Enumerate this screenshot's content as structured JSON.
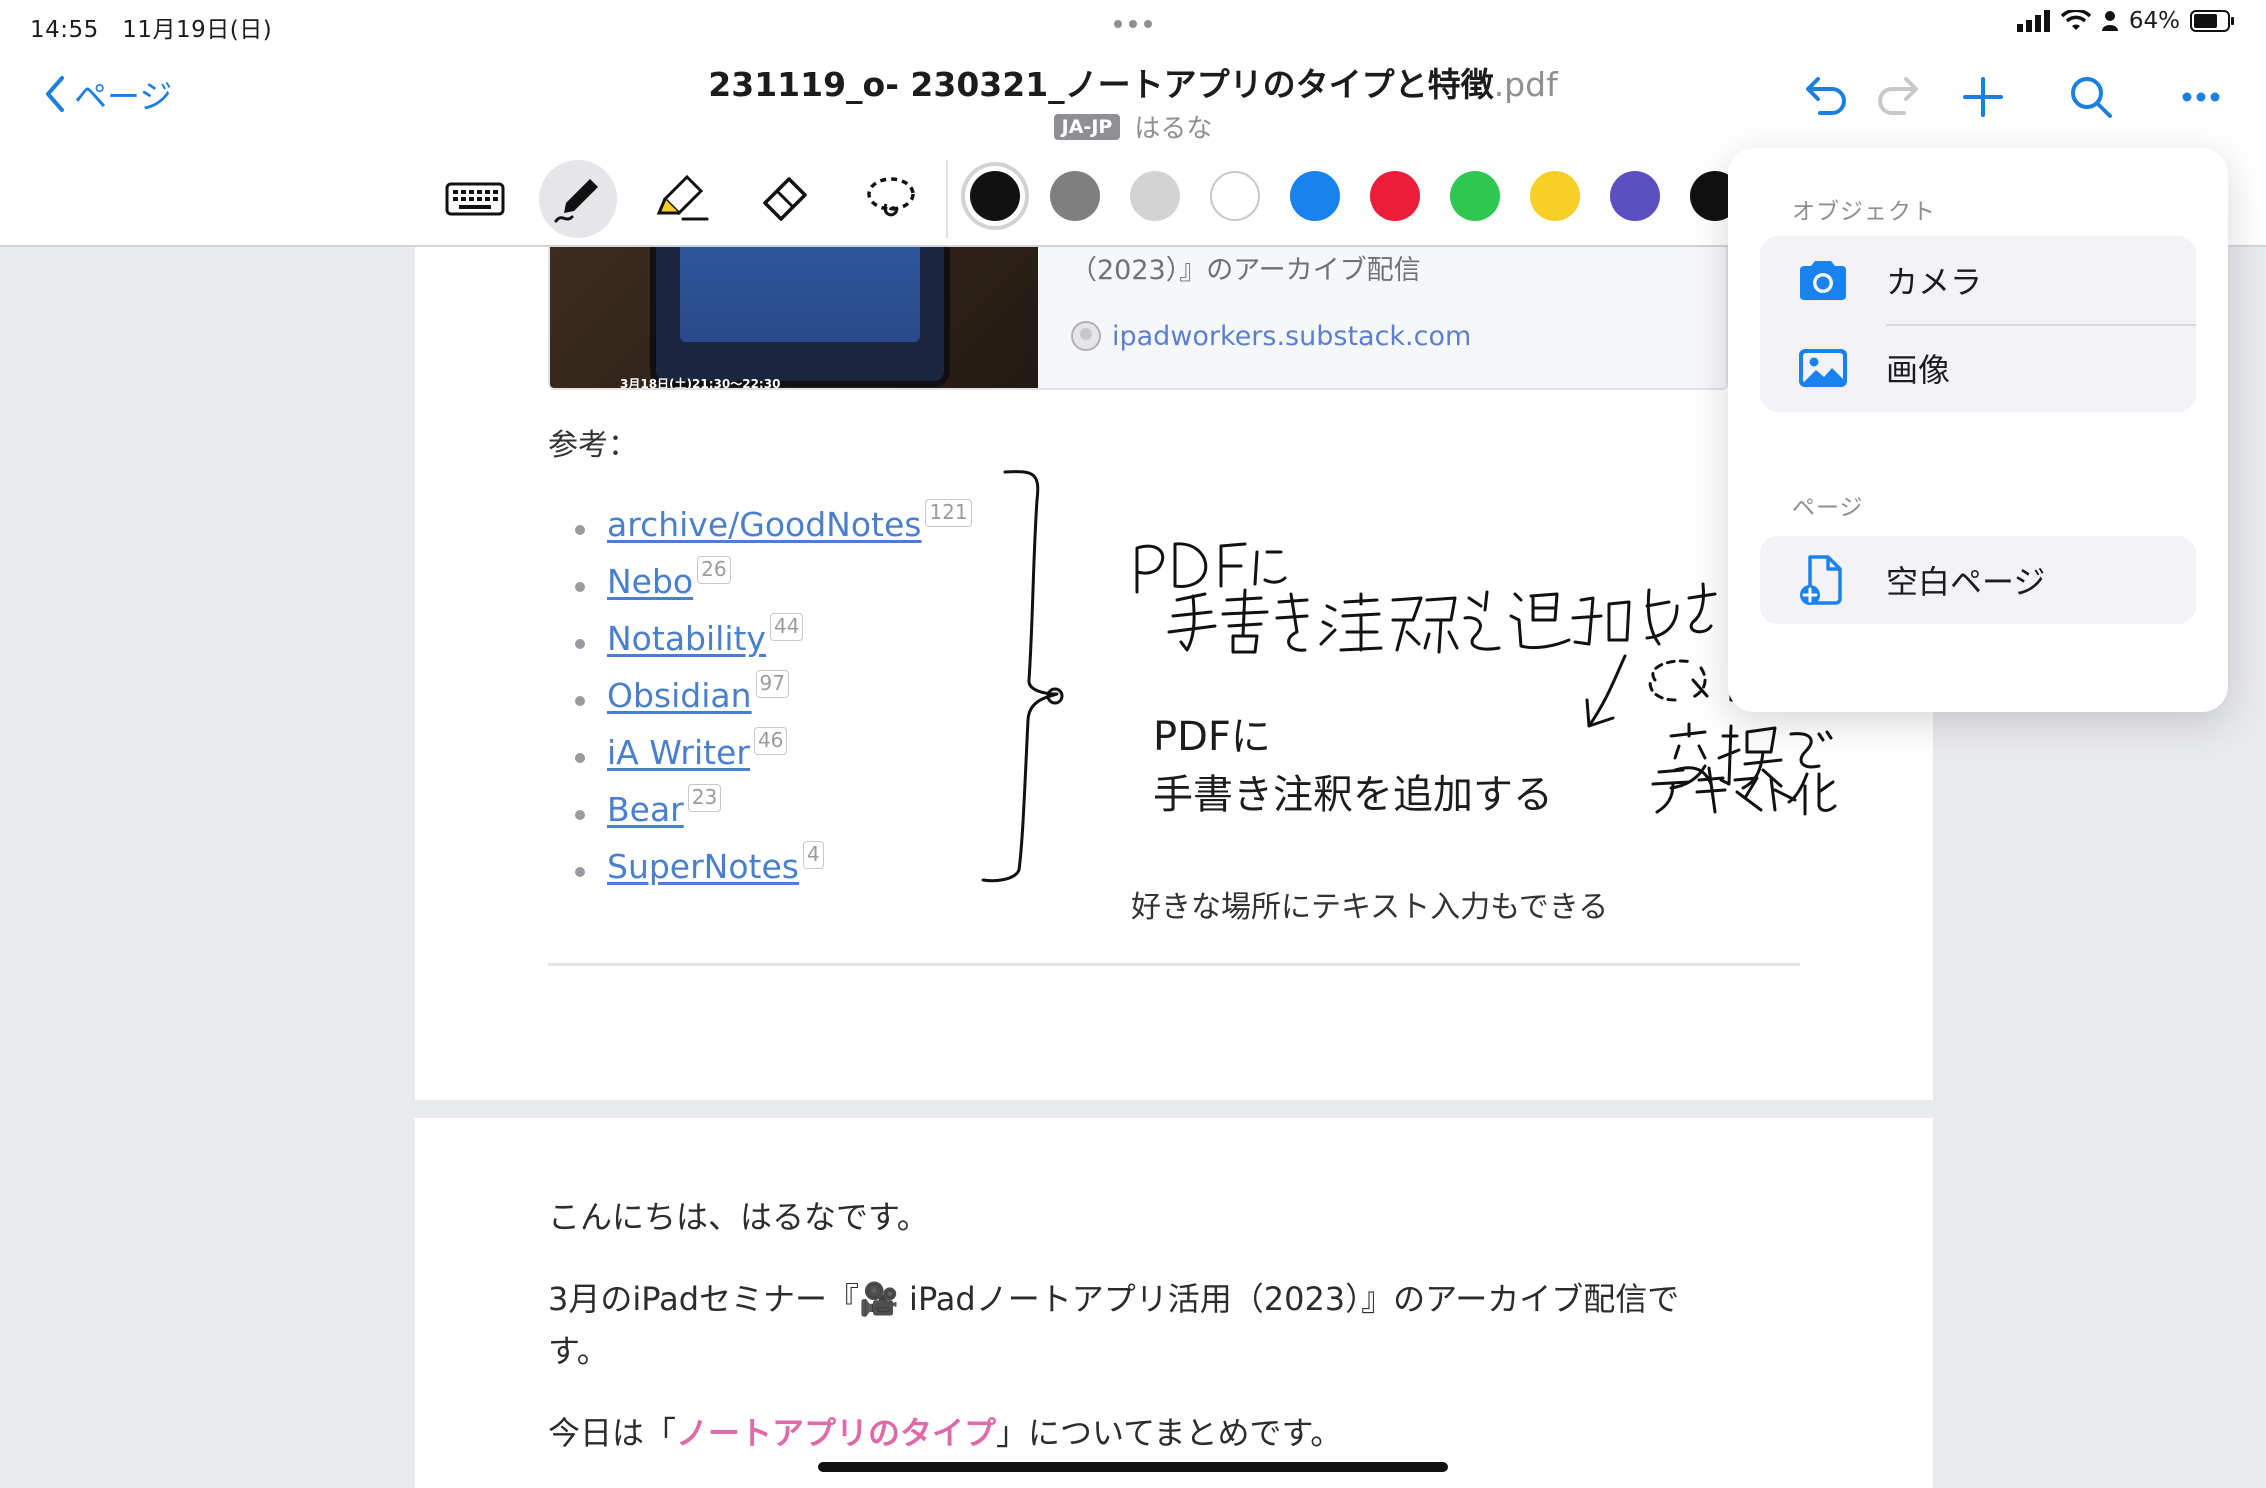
{
  "status": {
    "time": "14:55",
    "date": "11月19日(日)",
    "battery": "64%"
  },
  "header": {
    "back_label": "ページ",
    "title": "231119_o- 230321_ノートアプリのタイプと特徴",
    "title_ext": ".pdf",
    "lang": "JA-JP",
    "author": "はるな"
  },
  "toolbar": {
    "tools": [
      "keyboard-icon",
      "pen-icon",
      "highlighter-icon",
      "eraser-icon",
      "lasso-icon"
    ],
    "colors": [
      "#111111",
      "#7f7f7f",
      "#d3d3d3",
      "#ffffff",
      "#1a82ee",
      "#ec1d3a",
      "#2fc752",
      "#f7cf27",
      "#5b4fc2",
      "#111111"
    ]
  },
  "page1": {
    "preview_text": "（2023）』のアーカイブ配信",
    "preview_link": "ipadworkers.substack.com",
    "preview_date": "3月18日(土)21:30〜22:30",
    "ref_label": "参考：",
    "refs": [
      {
        "name": "archive/GoodNotes",
        "count": "121"
      },
      {
        "name": "Nebo",
        "count": "26"
      },
      {
        "name": "Notability",
        "count": "44"
      },
      {
        "name": "Obsidian",
        "count": "97"
      },
      {
        "name": "iA Writer",
        "count": "46"
      },
      {
        "name": "Bear",
        "count": "23"
      },
      {
        "name": "SuperNotes",
        "count": "4"
      }
    ],
    "typed_line1": "PDFに",
    "typed_line2": "手書き注釈を追加する",
    "caption": "好きな場所にテキスト入力もできる"
  },
  "page2": {
    "greeting": "こんにちは、はるなです。",
    "line2a": "3月のiPadセミナー『🎥 iPadノートアプリ活用（2023）』のアーカイブ配信で",
    "line2b": "す。",
    "line3_pre": "今日は「",
    "line3_hl": "ノートアプリのタイプ",
    "line3_post": "」についてまとめです。"
  },
  "popover": {
    "section_object": "オブジェクト",
    "camera": "カメラ",
    "image": "画像",
    "section_page": "ページ",
    "blank_page": "空白ページ"
  }
}
